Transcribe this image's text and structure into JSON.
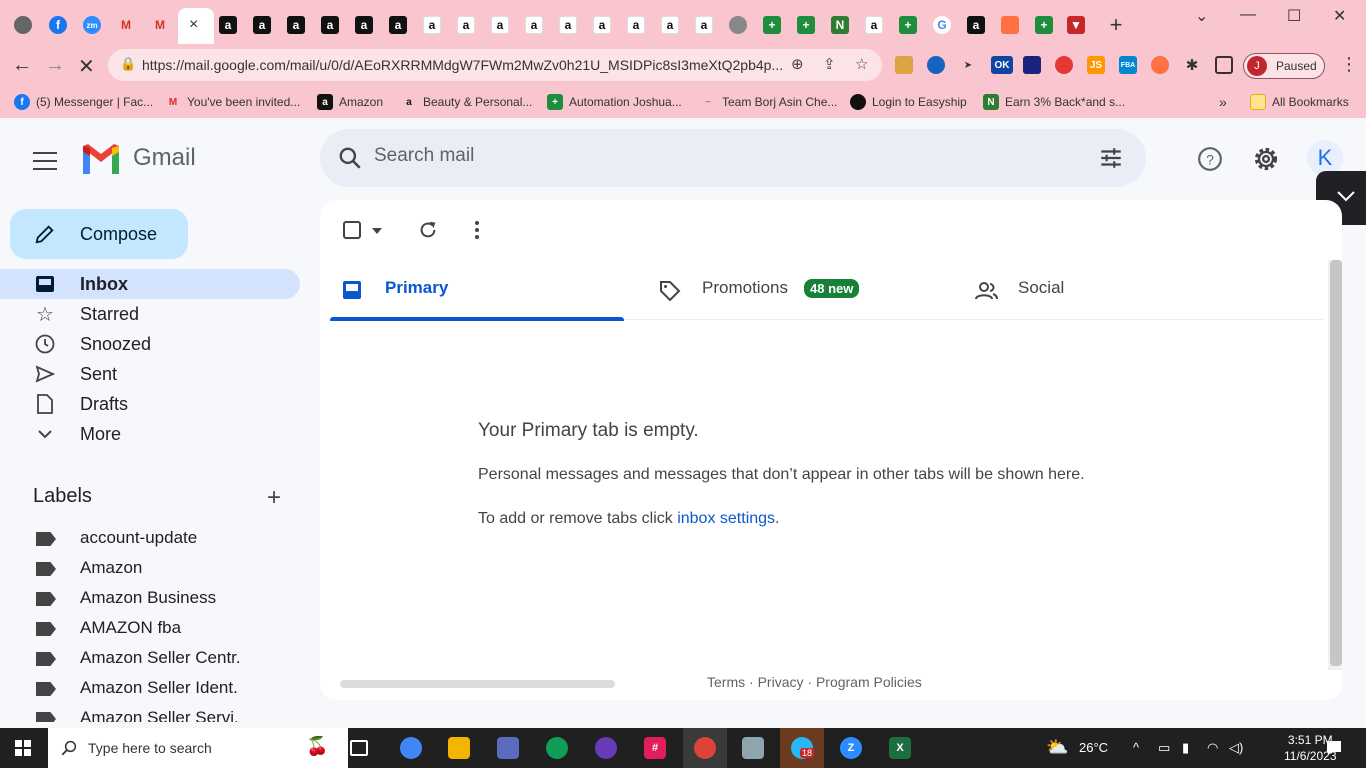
{
  "browser": {
    "url": "https://mail.google.com/mail/u/0/d/AEoRXRRMMdgW7FWm2MwZv0h21U_MSIDPic8sI3meXtQ2pb4p...",
    "profile_label": "Paused",
    "profile_initial": "J",
    "new_tab": "+",
    "tab_close": "×",
    "extension_badge_ok": "OK",
    "extension_js": "JS",
    "extension_fba": "FBA"
  },
  "bookmarks": {
    "items": [
      {
        "label": "(5) Messenger | Fac..."
      },
      {
        "label": "You've been invited..."
      },
      {
        "label": "Amazon"
      },
      {
        "label": "Beauty & Personal..."
      },
      {
        "label": "Automation Joshua..."
      },
      {
        "label": "Team Borj Asin Che..."
      },
      {
        "label": "Login to Easyship"
      },
      {
        "label": "Earn 3% Back*and s..."
      }
    ],
    "more": "»",
    "all": "All Bookmarks"
  },
  "gmail": {
    "logo_text": "Gmail",
    "search_placeholder": "Search mail",
    "avatar_initial": "K",
    "compose_label": "Compose",
    "nav": [
      {
        "label": "Inbox"
      },
      {
        "label": "Starred"
      },
      {
        "label": "Snoozed"
      },
      {
        "label": "Sent"
      },
      {
        "label": "Drafts"
      },
      {
        "label": "More"
      }
    ],
    "labels_heading": "Labels",
    "labels_add": "+",
    "labels": [
      {
        "label": "account-update"
      },
      {
        "label": "Amazon"
      },
      {
        "label": "Amazon Business"
      },
      {
        "label": "AMAZON fba"
      },
      {
        "label": "Amazon Seller Centr."
      },
      {
        "label": "Amazon Seller Ident."
      },
      {
        "label": "Amazon Seller Servi."
      }
    ],
    "tabs": [
      {
        "label": "Primary"
      },
      {
        "label": "Promotions",
        "badge": "48 new"
      },
      {
        "label": "Social"
      }
    ],
    "empty": {
      "heading": "Your Primary tab is empty.",
      "line1": "Personal messages and messages that don’t appear in other tabs will be shown here.",
      "line2_prefix": "To add or remove tabs click ",
      "line2_link": "inbox settings",
      "line2_suffix": "."
    },
    "footer": {
      "terms": "Terms",
      "privacy": "Privacy",
      "policies": "Program Policies",
      "sep": "·"
    }
  },
  "taskbar": {
    "search_placeholder": "Type here to search",
    "temperature": "26°C",
    "time": "3:51 PM",
    "date": "11/6/2023",
    "zoom_badge": "18"
  },
  "colors": {
    "chrome_pink": "#f9c6cf",
    "gmail_blue": "#0b57d0",
    "compose_bg": "#c2e7ff",
    "badge_green": "#188038"
  }
}
